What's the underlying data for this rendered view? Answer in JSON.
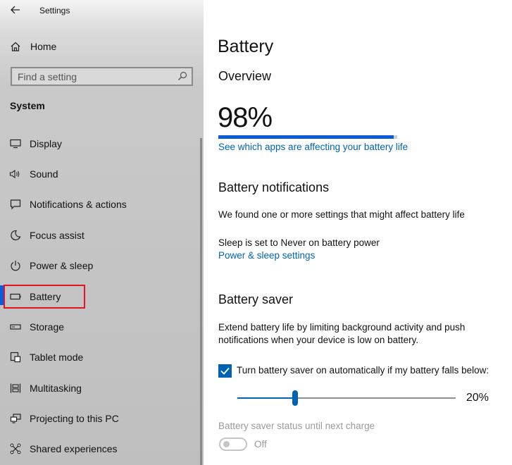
{
  "app": {
    "title": "Settings"
  },
  "sidebar": {
    "home_label": "Home",
    "search": {
      "placeholder": "Find a setting"
    },
    "section_title": "System",
    "items": [
      {
        "label": "Display",
        "icon": "monitor-icon"
      },
      {
        "label": "Sound",
        "icon": "speaker-icon"
      },
      {
        "label": "Notifications & actions",
        "icon": "notification-icon"
      },
      {
        "label": "Focus assist",
        "icon": "moon-icon"
      },
      {
        "label": "Power & sleep",
        "icon": "power-icon"
      },
      {
        "label": "Battery",
        "icon": "battery-icon",
        "selected": true
      },
      {
        "label": "Storage",
        "icon": "storage-icon"
      },
      {
        "label": "Tablet mode",
        "icon": "tablet-mode-icon"
      },
      {
        "label": "Multitasking",
        "icon": "multitasking-icon"
      },
      {
        "label": "Projecting to this PC",
        "icon": "projecting-icon"
      },
      {
        "label": "Shared experiences",
        "icon": "shared-experiences-icon"
      }
    ]
  },
  "main": {
    "title": "Battery",
    "overview": {
      "heading": "Overview",
      "percent_text": "98%",
      "level": 0.98,
      "apps_link": "See which apps are affecting your battery life"
    },
    "notifications": {
      "heading": "Battery notifications",
      "message": "We found one or more settings that might affect battery life",
      "sleep_text": "Sleep is set to Never on battery power",
      "power_link": "Power & sleep settings"
    },
    "saver": {
      "heading": "Battery saver",
      "description": "Extend battery life by limiting background activity and push notifications when your device is low on battery.",
      "checkbox_label": "Turn battery saver on automatically if my battery falls below:",
      "checkbox_checked": true,
      "threshold_value": 20,
      "threshold_text": "20%",
      "status_label": "Battery saver status until next charge",
      "toggle_state": "Off"
    }
  },
  "colors": {
    "accent": "#0063b1",
    "selected_marker": "#0060df",
    "highlight_box": "#e81123"
  }
}
